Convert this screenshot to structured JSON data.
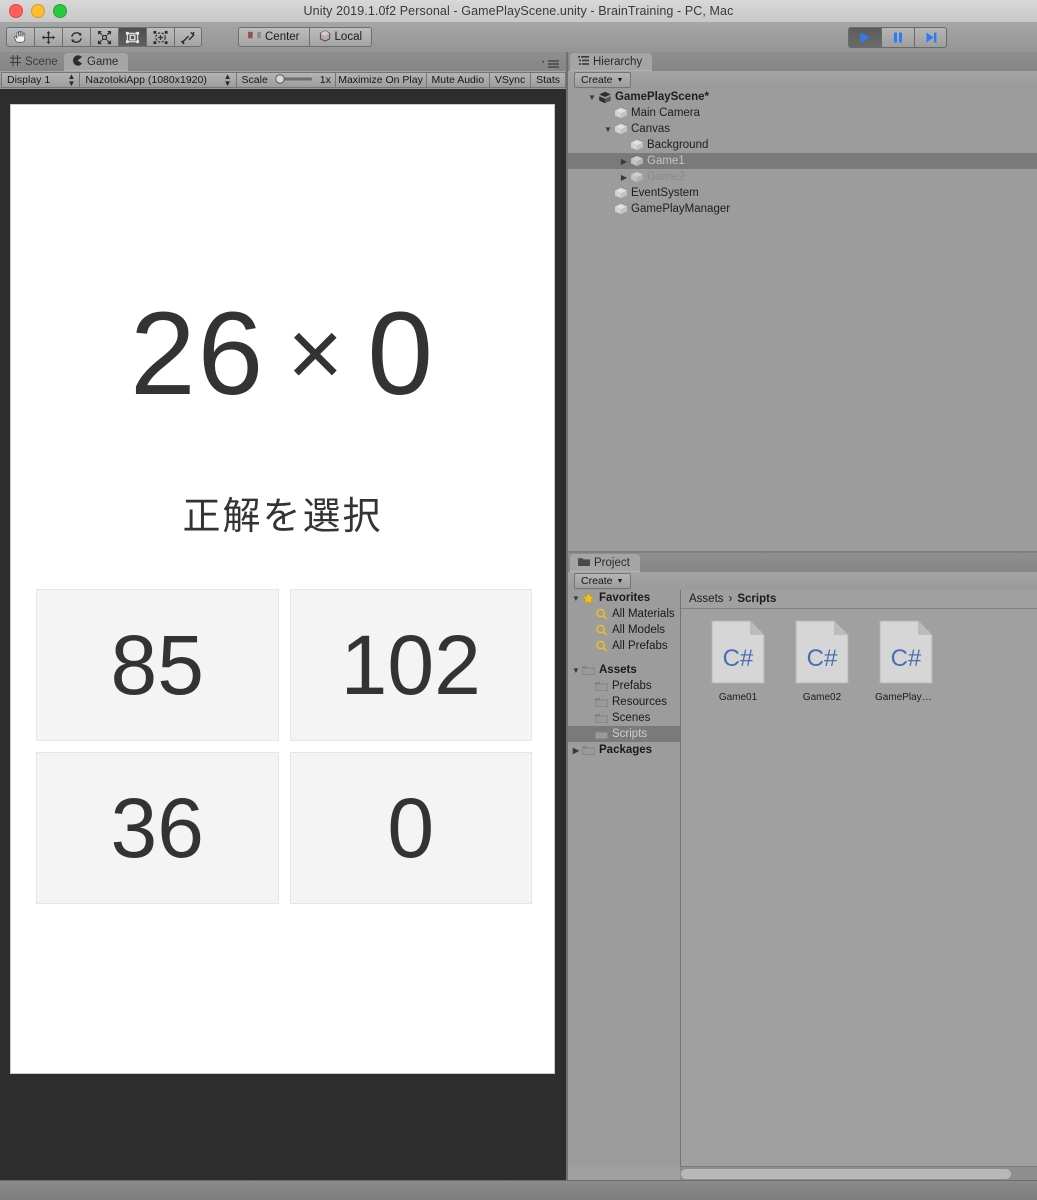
{
  "window": {
    "title": "Unity 2019.1.0f2 Personal - GamePlayScene.unity - BrainTraining - PC, Mac",
    "traffic_lights": [
      "close",
      "minimize",
      "zoom"
    ]
  },
  "toolbar": {
    "transform_tools": [
      {
        "name": "hand-tool",
        "active": false
      },
      {
        "name": "move-tool",
        "active": false
      },
      {
        "name": "rotate-tool",
        "active": false
      },
      {
        "name": "scale-tool",
        "active": false
      },
      {
        "name": "rect-tool",
        "active": true
      },
      {
        "name": "transform-tool",
        "active": false
      },
      {
        "name": "custom-tool",
        "active": false
      }
    ],
    "pivot_label": "Center",
    "space_label": "Local",
    "play_label": "▶",
    "pause_label": "❙❙",
    "step_label": "▶❙",
    "accent_color": "#2f7bf6"
  },
  "game_view": {
    "tabs": [
      {
        "label": "Scene",
        "active": false
      },
      {
        "label": "Game",
        "active": true
      }
    ],
    "display": "Display 1",
    "resolution": "NazotokiApp (1080x1920)",
    "scale_label": "Scale",
    "scale_value": "1x",
    "maximize_on_play": "Maximize On Play",
    "mute_audio": "Mute Audio",
    "vsync": "VSync",
    "stats": "Stats",
    "background_color": "#2d2d2d"
  },
  "game_content": {
    "operand_left": "26",
    "operator": "×",
    "operand_right": "0",
    "instruction": "正解を選択",
    "answers": [
      "85",
      "102",
      "36",
      "0"
    ],
    "text_color": "#333333",
    "answer_bg": "#f4f4f4"
  },
  "hierarchy": {
    "tab_label": "Hierarchy",
    "create_label": "Create",
    "items": [
      {
        "label": "GamePlayScene*",
        "depth": 0,
        "twisty": "down",
        "icon": "scene-icon",
        "bold": true,
        "selected": false,
        "dim": false
      },
      {
        "label": "Main Camera",
        "depth": 1,
        "twisty": "",
        "icon": "gameobject-icon",
        "bold": false,
        "selected": false,
        "dim": false
      },
      {
        "label": "Canvas",
        "depth": 1,
        "twisty": "down",
        "icon": "gameobject-icon",
        "bold": false,
        "selected": false,
        "dim": false
      },
      {
        "label": "Background",
        "depth": 2,
        "twisty": "",
        "icon": "gameobject-icon",
        "bold": false,
        "selected": false,
        "dim": false
      },
      {
        "label": "Game1",
        "depth": 2,
        "twisty": "right",
        "icon": "gameobject-icon",
        "bold": false,
        "selected": true,
        "dim": true
      },
      {
        "label": "Game2",
        "depth": 2,
        "twisty": "right",
        "icon": "gameobject-icon",
        "bold": false,
        "selected": false,
        "dim": true
      },
      {
        "label": "EventSystem",
        "depth": 1,
        "twisty": "",
        "icon": "gameobject-icon",
        "bold": false,
        "selected": false,
        "dim": false
      },
      {
        "label": "GamePlayManager",
        "depth": 1,
        "twisty": "",
        "icon": "gameobject-icon",
        "bold": false,
        "selected": false,
        "dim": false
      }
    ]
  },
  "project": {
    "tab_label": "Project",
    "create_label": "Create",
    "tree": [
      {
        "label": "Favorites",
        "depth": 0,
        "twisty": "down",
        "icon": "star-icon",
        "bold": true,
        "selected": false
      },
      {
        "label": "All Materials",
        "depth": 1,
        "twisty": "",
        "icon": "search-icon",
        "bold": false,
        "selected": false
      },
      {
        "label": "All Models",
        "depth": 1,
        "twisty": "",
        "icon": "search-icon",
        "bold": false,
        "selected": false
      },
      {
        "label": "All Prefabs",
        "depth": 1,
        "twisty": "",
        "icon": "search-icon",
        "bold": false,
        "selected": false
      },
      {
        "label": "",
        "depth": 0,
        "twisty": "",
        "icon": "",
        "bold": false,
        "selected": false
      },
      {
        "label": "Assets",
        "depth": 0,
        "twisty": "down",
        "icon": "folder-icon",
        "bold": true,
        "selected": false
      },
      {
        "label": "Prefabs",
        "depth": 1,
        "twisty": "",
        "icon": "folder-icon",
        "bold": false,
        "selected": false
      },
      {
        "label": "Resources",
        "depth": 1,
        "twisty": "",
        "icon": "folder-icon",
        "bold": false,
        "selected": false
      },
      {
        "label": "Scenes",
        "depth": 1,
        "twisty": "",
        "icon": "folder-icon",
        "bold": false,
        "selected": false
      },
      {
        "label": "Scripts",
        "depth": 1,
        "twisty": "",
        "icon": "folder-icon",
        "bold": false,
        "selected": true
      },
      {
        "label": "Packages",
        "depth": 0,
        "twisty": "right",
        "icon": "folder-icon",
        "bold": true,
        "selected": false
      }
    ],
    "breadcrumb": [
      "Assets",
      "Scripts"
    ],
    "breadcrumb_separator": "›",
    "assets": [
      {
        "label": "Game01",
        "type": "csharp-script",
        "badge": "C#"
      },
      {
        "label": "Game02",
        "type": "csharp-script",
        "badge": "C#"
      },
      {
        "label": "GamePlayMa...",
        "type": "csharp-script",
        "badge": "C#"
      }
    ]
  }
}
